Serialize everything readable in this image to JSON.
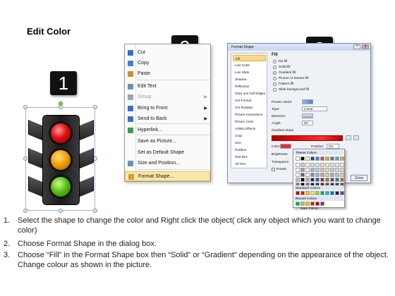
{
  "title": "Edit Color",
  "badges": [
    "1",
    "2",
    "3"
  ],
  "context_menu": {
    "items": [
      {
        "label": "Cut",
        "icon": "scissors-icon",
        "disabled": false,
        "submenu": false
      },
      {
        "label": "Copy",
        "icon": "copy-icon",
        "disabled": false,
        "submenu": false
      },
      {
        "label": "Paste",
        "icon": "paste-icon",
        "disabled": false,
        "submenu": false
      },
      {
        "label": "Edit Text",
        "icon": "text-box-icon",
        "disabled": false,
        "submenu": false
      },
      {
        "label": "Group",
        "icon": "group-icon",
        "disabled": true,
        "submenu": true
      },
      {
        "label": "Bring to Front",
        "icon": "bring-front-icon",
        "disabled": false,
        "submenu": true
      },
      {
        "label": "Send to Back",
        "icon": "send-back-icon",
        "disabled": false,
        "submenu": true
      },
      {
        "label": "Hyperlink...",
        "icon": "hyperlink-icon",
        "disabled": false,
        "submenu": false
      },
      {
        "label": "Save as Picture...",
        "icon": "",
        "disabled": false,
        "submenu": false
      },
      {
        "label": "Set as Default Shape",
        "icon": "",
        "disabled": false,
        "submenu": false
      },
      {
        "label": "Size and Position...",
        "icon": "size-icon",
        "disabled": false,
        "submenu": false
      },
      {
        "label": "Format Shape...",
        "icon": "format-shape-icon",
        "disabled": false,
        "submenu": false,
        "highlighted": true
      }
    ]
  },
  "dialog": {
    "title": "Format Shape",
    "window_buttons": [
      "?",
      "x"
    ],
    "categories": [
      "Fill",
      "Line Color",
      "Line Style",
      "Shadow",
      "Reflection",
      "Glow and Soft Edges",
      "3-D Format",
      "3-D Rotation",
      "Picture Corrections",
      "Picture Color",
      "Artistic Effects",
      "Crop",
      "Size",
      "Position",
      "Text Box",
      "Alt Text"
    ],
    "selected_category": "Fill",
    "fill_heading": "Fill",
    "fill_options": [
      {
        "label": "No fill",
        "checked": false
      },
      {
        "label": "Solid fill",
        "checked": false
      },
      {
        "label": "Gradient fill",
        "checked": true
      },
      {
        "label": "Picture or texture fill",
        "checked": false
      },
      {
        "label": "Pattern fill",
        "checked": false
      },
      {
        "label": "Slide background fill",
        "checked": false
      }
    ],
    "fields": {
      "preset_colors": "Preset colors:",
      "type_label": "Type:",
      "type_value": "Linear",
      "direction_label": "Direction:",
      "angle_label": "Angle:",
      "angle_value": "90°",
      "gradient_stops": "Gradient stops",
      "color_label": "Color",
      "position_label": "Position:",
      "position_value": "0%",
      "brightness_label": "Brightness",
      "transparency_label": "Transparen",
      "rotate_label": "Rotate"
    },
    "close_button": "Close"
  },
  "color_popup": {
    "theme_heading": "Theme Colors",
    "standard_heading": "Standard Colors",
    "recent_heading": "Recent Colors",
    "more_colors": "More Colors...",
    "theme_colors": [
      "#ffffff",
      "#000000",
      "#eeece1",
      "#1f497d",
      "#4f81bd",
      "#c0504d",
      "#9bbb59",
      "#8064a2",
      "#4bacc6",
      "#f79646"
    ],
    "standard_colors": [
      "#c00000",
      "#ff0000",
      "#ffc000",
      "#ffff00",
      "#92d050",
      "#00b050",
      "#00b0f0",
      "#0070c0",
      "#002060",
      "#7030a0"
    ],
    "recent_colors": [
      "#00b050",
      "#92d050",
      "#ffc000",
      "#ff0000",
      "#c00000",
      "#7030a0"
    ]
  },
  "instructions": [
    {
      "num": "1.",
      "text": "Select the shape to change the color and Right click the object( click any object which you want to change color)"
    },
    {
      "num": "2.",
      "text": "Choose Format Shape in the dialog box."
    },
    {
      "num": "3.",
      "text": "Choose “Fill” in the Format Shape box then “Solid” or “Gradient” depending on the appearance of the object. Change colour as shown in the picture."
    }
  ]
}
